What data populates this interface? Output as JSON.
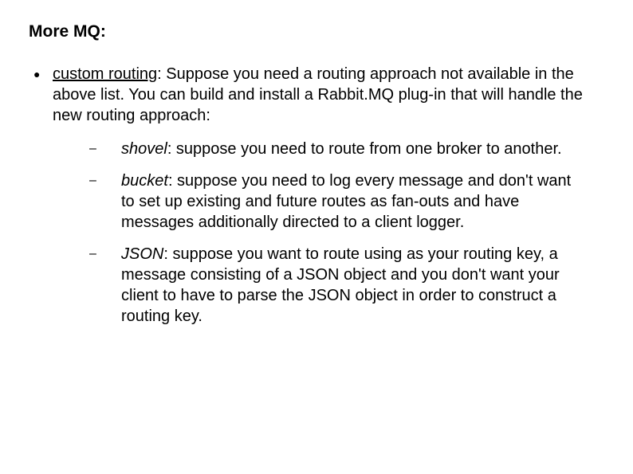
{
  "title": "More MQ:",
  "main": {
    "lead": "custom routing",
    "text": ": Suppose you need a routing approach not available in the above list. You can build and install a Rabbit.MQ plug-in that will handle the new routing approach:"
  },
  "items": [
    {
      "lead": "shovel",
      "text": ": suppose you need to route from one broker to another."
    },
    {
      "lead": "bucket",
      "text": ": suppose you need to log every message and don't want to set up existing and future routes as fan-outs and have messages additionally directed to a client logger."
    },
    {
      "lead": "JSON",
      "text": ": suppose you want to route using as your routing key, a message consisting of a JSON object and you don't want your client to have to parse the JSON object in order to construct a routing key."
    }
  ],
  "bullets": {
    "disc": "●",
    "dash": "–"
  }
}
